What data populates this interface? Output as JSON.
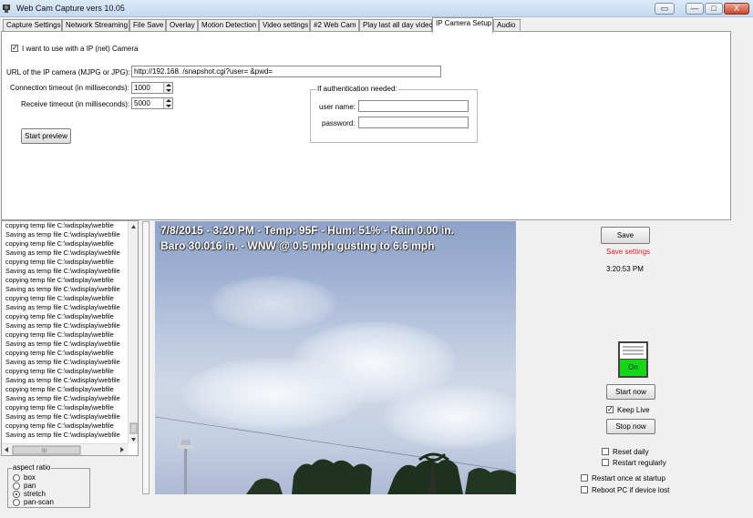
{
  "window": {
    "title": "Web Cam Capture vers 10.05",
    "controls": {
      "minimize": "▭",
      "restore": "—",
      "maximize": "□",
      "close": "X"
    }
  },
  "tabs": [
    "Capture Settings",
    "Network Streaming",
    "File Save",
    "Overlay",
    "Motion Detection",
    "Video settings",
    "#2 Web Cam",
    "Play last all day video",
    "IP Camera Setup",
    "Audio"
  ],
  "active_tab": "IP Camera Setup",
  "ip_camera": {
    "use_ip_label": "I want to use with a IP (net) Camera",
    "use_ip_checked": "✓",
    "url_label": "URL of the IP camera (MJPG or JPG):",
    "url_value": "http://192.168.        /snapshot.cgi?user=   &pwd=",
    "conn_timeout_label": "Connection timeout  (in milliseconds):",
    "conn_timeout_value": "1000",
    "recv_timeout_label": "Receive timeout (in milliseconds):",
    "recv_timeout_value": "5000",
    "start_preview": "Start preview",
    "auth_group_title": "If authentication needed:",
    "username_label": "user name:",
    "password_label": "password:",
    "username_value": "",
    "password_value": ""
  },
  "log_lines": [
    "copying temp file C:\\wdisplay\\webfile",
    "Saving as temp file C:\\wdisplay\\webfile",
    "copying temp file C:\\wdisplay\\webfile",
    "Saving as temp file C:\\wdisplay\\webfile",
    "copying temp file C:\\wdisplay\\webfile",
    "Saving as temp file C:\\wdisplay\\webfile",
    "copying temp file C:\\wdisplay\\webfile",
    "Saving as temp file C:\\wdisplay\\webfile",
    "copying temp file C:\\wdisplay\\webfile",
    "Saving as temp file C:\\wdisplay\\webfile",
    "copying temp file C:\\wdisplay\\webfile",
    "Saving as temp file C:\\wdisplay\\webfile",
    "copying temp file C:\\wdisplay\\webfile",
    "Saving as temp file C:\\wdisplay\\webfile",
    "copying temp file C:\\wdisplay\\webfile",
    "Saving as temp file C:\\wdisplay\\webfile",
    "copying temp file C:\\wdisplay\\webfile",
    "Saving as temp file C:\\wdisplay\\webfile",
    "copying temp file C:\\wdisplay\\webfile",
    "Saving as temp file C:\\wdisplay\\webfile",
    "copying temp file C:\\wdisplay\\webfile",
    "Saving as temp file C:\\wdisplay\\webfile",
    "copying temp file C:\\wdisplay\\webfile",
    "Saving as temp file C:\\wdisplay\\webfile"
  ],
  "aspect_ratio": {
    "title": "aspect ratio",
    "options": [
      "box",
      "pan",
      "stretch",
      "pan-scan"
    ],
    "selected": "stretch"
  },
  "camera_overlay": {
    "line1": "7/8/2015 - 3:20 PM - Temp: 95F - Hum: 51% - Rain 0.00 in.",
    "line2": "Baro 30.016 in. - WNW @ 0.5 mph  gusting to 6.6 mph"
  },
  "right_panel": {
    "save_button": "Save",
    "save_settings_label": "Save settings",
    "save_settings_color": "#e02020",
    "time": "3:20:53 PM",
    "switch_label": "On",
    "switch_color": "#16d616",
    "start_now": "Start now",
    "keep_live_label": "Keep Live",
    "keep_live_checked": "✓",
    "stop_now": "Stop now",
    "reset_daily": "Reset daily",
    "restart_regularly": "Restart regularly",
    "restart_startup": "Restart once at startup",
    "reboot_pc": "Reboot PC if device lost"
  }
}
